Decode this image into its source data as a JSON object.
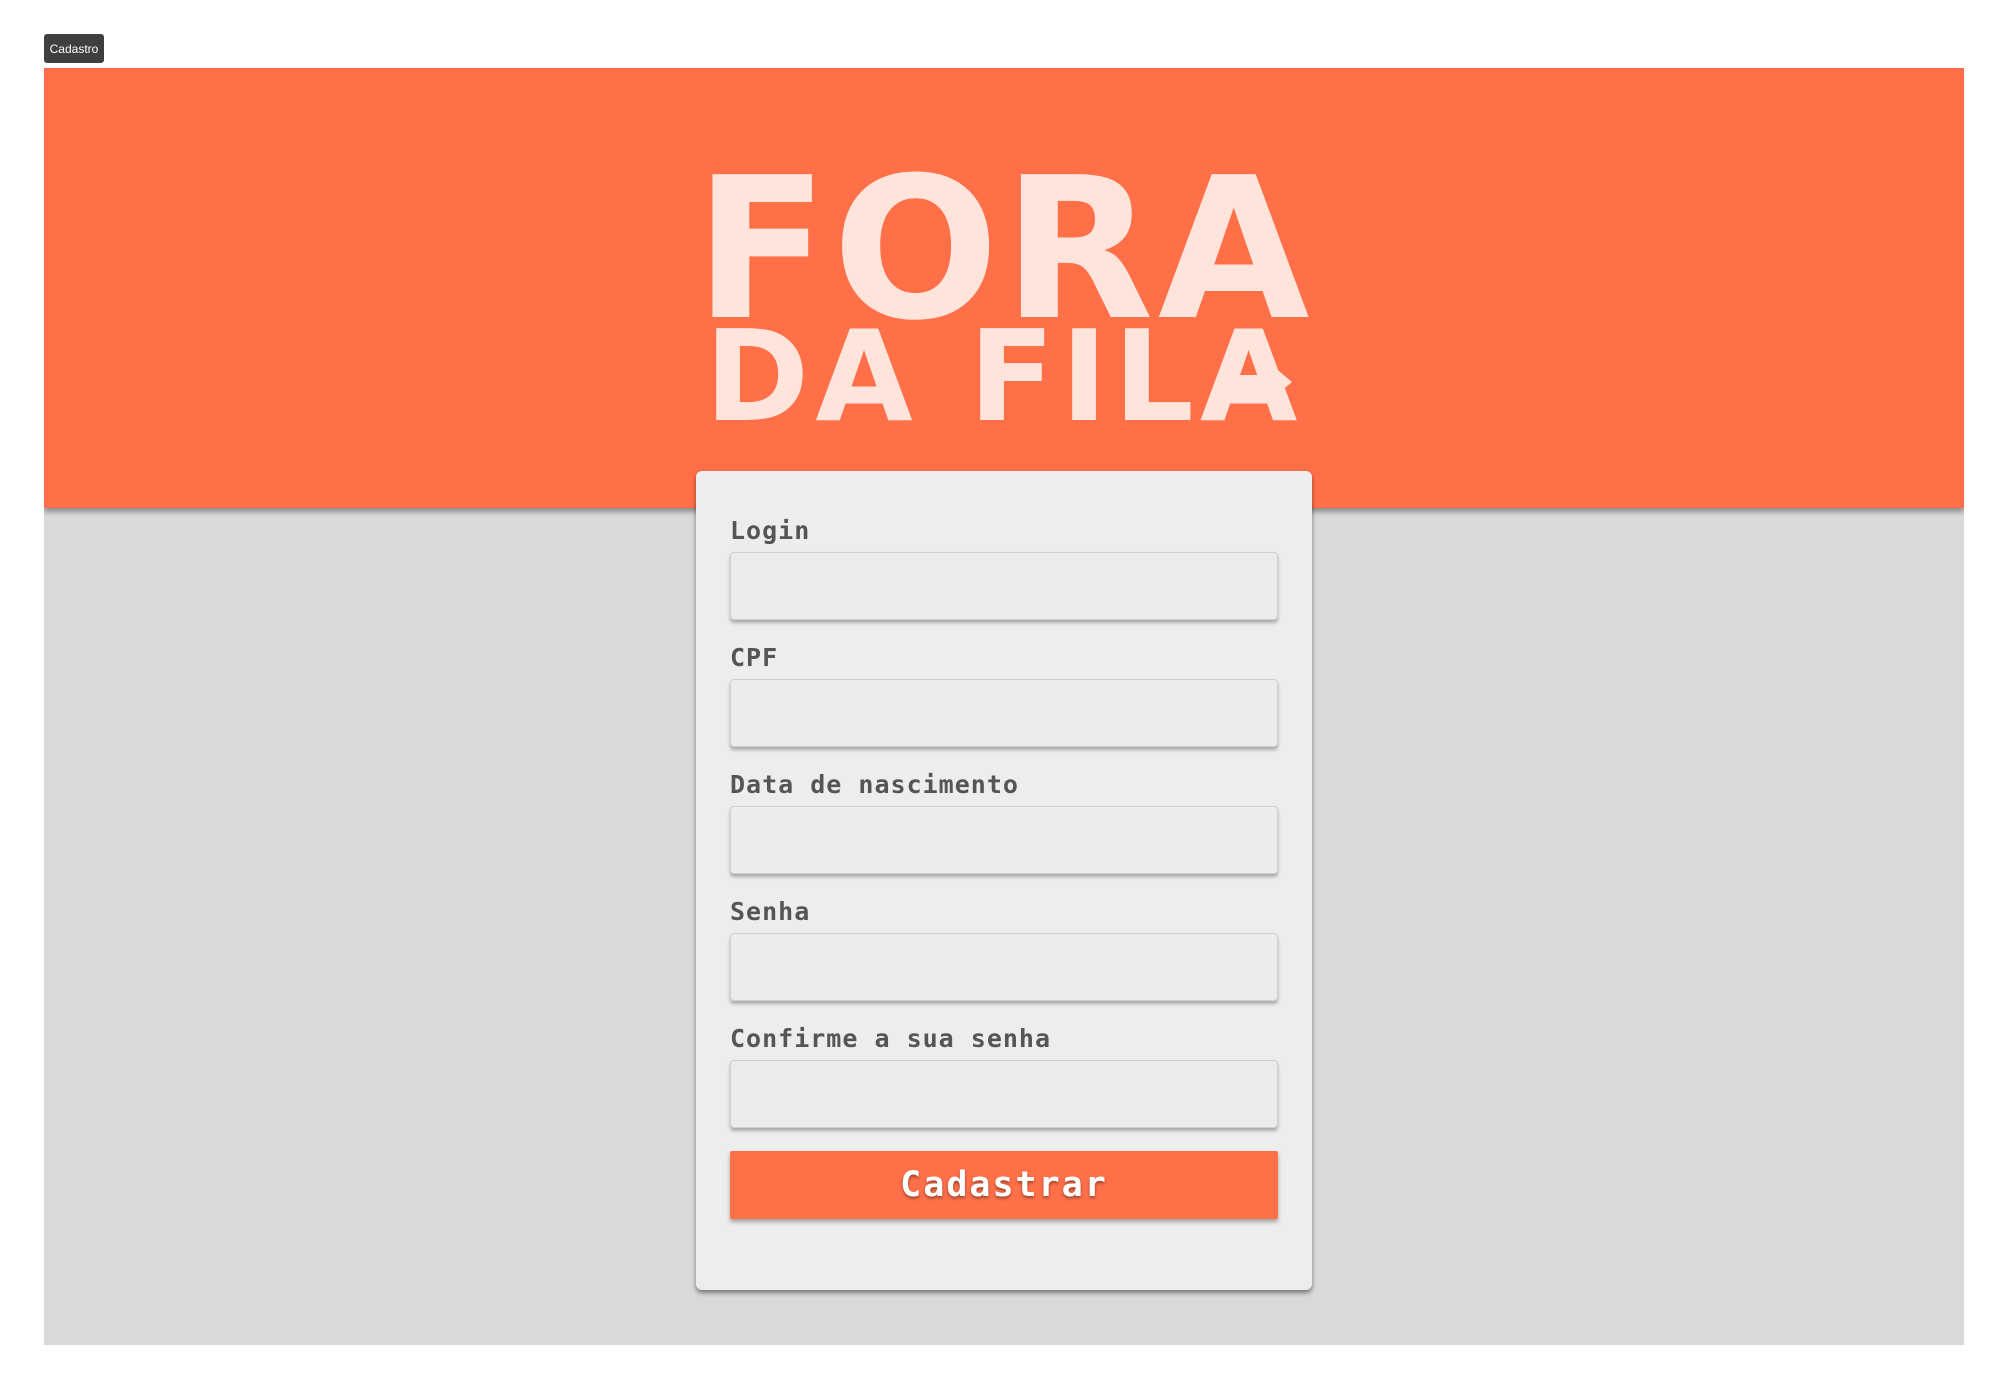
{
  "frame": {
    "label": "Cadastro"
  },
  "brand": {
    "name_line1": "FORA",
    "name_line2": "DA FILA",
    "primary_color": "#ff7049",
    "logo_color": "#ffe4dc",
    "background_color": "#d9d9d9",
    "card_color": "#ededed"
  },
  "form": {
    "fields": [
      {
        "label": "Login",
        "value": "",
        "placeholder": ""
      },
      {
        "label": "CPF",
        "value": "",
        "placeholder": ""
      },
      {
        "label": "Data de nascimento",
        "value": "",
        "placeholder": ""
      },
      {
        "label": "Senha",
        "value": "",
        "placeholder": ""
      },
      {
        "label": "Confirme a sua senha",
        "value": "",
        "placeholder": ""
      }
    ],
    "submit_label": "Cadastrar"
  },
  "icons": {
    "logo_arrow": "arrow-right-icon"
  }
}
